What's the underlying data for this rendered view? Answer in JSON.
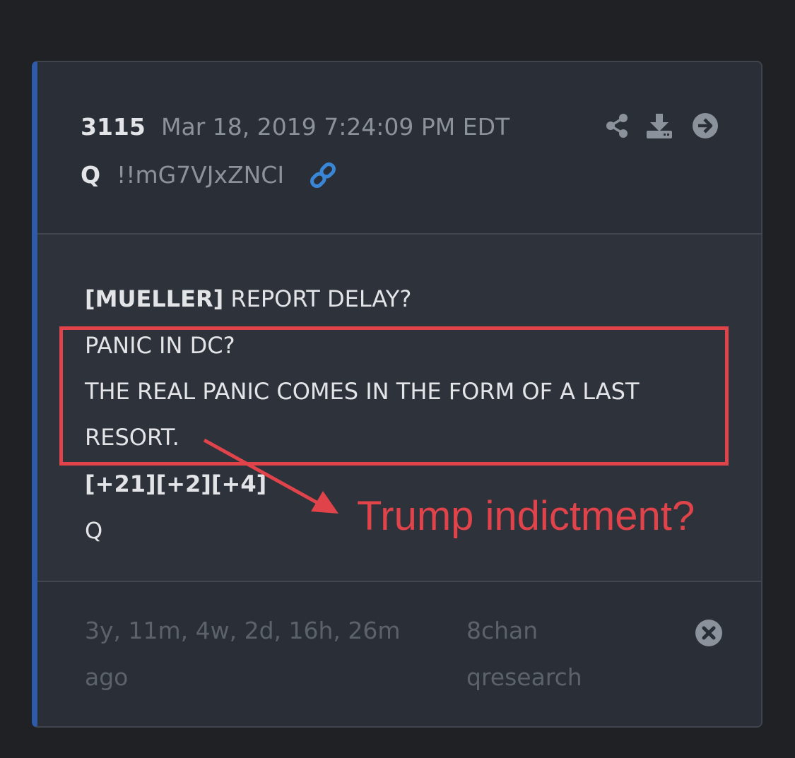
{
  "post": {
    "number": "3115",
    "date": "Mar 18, 2019 7:24:09 PM EDT",
    "author": "Q",
    "tripcode": "!!mG7VJxZNCI"
  },
  "header_icons": [
    "share-icon",
    "download-icon",
    "arrow-right-circle-icon",
    "link-icon"
  ],
  "body": {
    "line1_bold": "[MUELLER]",
    "line1_rest": " REPORT DELAY?",
    "line2": "PANIC IN DC?",
    "line3": "THE REAL PANIC COMES IN THE FORM OF A LAST",
    "line4": "RESORT.",
    "line5": "[+21][+2][+4]",
    "line6": "Q"
  },
  "annotation": {
    "text": "Trump indictment?",
    "color": "#e0434a"
  },
  "footer": {
    "elapsed": "3y, 11m, 4w, 2d, 16h, 26m ago",
    "source": "8chan qresearch"
  },
  "colors": {
    "accent_left_border": "#2e5aa8",
    "link_icon": "#3a86d6",
    "background": "#1f2125",
    "card": "#2c3038"
  }
}
